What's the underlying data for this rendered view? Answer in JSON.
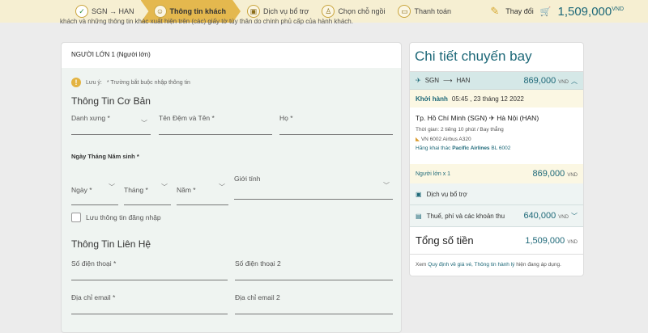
{
  "steps": [
    {
      "label": "SGN → HAN",
      "icon": "check-icon"
    },
    {
      "label": "Thông tin khách",
      "icon": "passenger-icon"
    },
    {
      "label": "Dịch vụ bổ trợ",
      "icon": "luggage-icon"
    },
    {
      "label": "Chọn chỗ ngồi",
      "icon": "seat-icon"
    },
    {
      "label": "Thanh toán",
      "icon": "card-icon"
    }
  ],
  "header": {
    "change_label": "Thay đổi",
    "total": "1,509,000",
    "currency": "VND"
  },
  "intro": "khách và những thông tin khác xuất hiện trên (các) giấy tờ tùy thân do chính phủ cấp của hành khách.",
  "form": {
    "title": "NGƯỜI LỚN 1 (Người lớn)",
    "note_label": "Lưu ý:",
    "note_text": "* Trường bắt buộc nhập thông tin",
    "basic_title": "Thông Tin Cơ Bản",
    "title_field": "Danh xưng *",
    "given_name": "Tên Đệm và Tên *",
    "surname": "Họ *",
    "dob_label": "Ngày Tháng Năm sinh *",
    "day": "Ngày *",
    "month": "Tháng *",
    "year": "Năm *",
    "gender": "Giới tính",
    "save_info": "Lưu thông tin đăng nhập",
    "contact_title": "Thông Tin Liên Hệ",
    "phone": "Số điện thoại *",
    "phone2": "Số điện thoại 2",
    "email": "Địa chỉ email *",
    "email2": "Địa chỉ email 2"
  },
  "panel": {
    "title": "Chi tiết chuyến bay",
    "route_from": "SGN",
    "route_to": "HAN",
    "route_price": "869,000",
    "currency": "VND",
    "depart_label": "Khởi hành",
    "depart_time": "05:45 , 23 tháng 12 2022",
    "from_city": "Tp. Hồ Chí Minh (SGN)",
    "to_city": "Hà Nội (HAN)",
    "duration": "Thời gian: 2 tiếng 10 phút / Bay thẳng",
    "flight": "VN 6002 Airbus A320",
    "operator_label": "Hãng khai thác",
    "operator": "Pacific Airlines",
    "operator_code": "BL 6002",
    "adult_label": "Người lớn x 1",
    "adult_price": "869,000",
    "services": "Dịch vụ bổ trợ",
    "taxes": "Thuế, phí và các khoản thu",
    "taxes_price": "640,000",
    "total_label": "Tổng số tiền",
    "total_price": "1,509,000",
    "footer_pre": "Xem",
    "footer_link1": "Quy định về giá vé,",
    "footer_link2": "Thông tin hành lý",
    "footer_post": "hiện đang áp dụng."
  }
}
